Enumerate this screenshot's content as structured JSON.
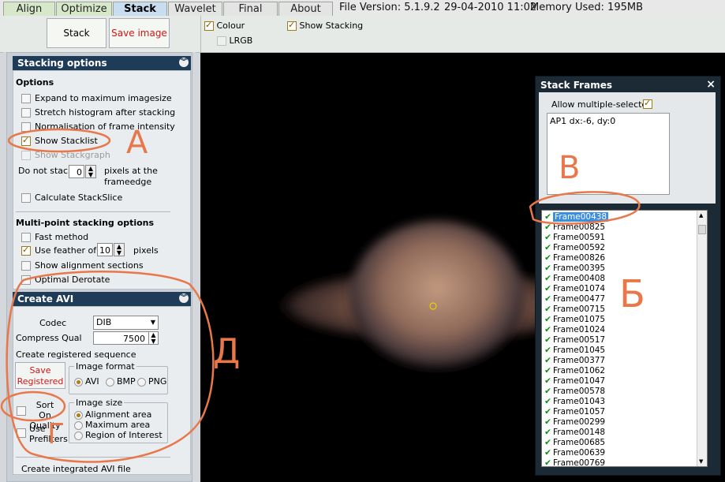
{
  "tabs": [
    {
      "label": "Align",
      "active": false
    },
    {
      "label": "Optimize",
      "active": false
    },
    {
      "label": "Stack",
      "active": true
    },
    {
      "label": "Wavelet",
      "active": false
    },
    {
      "label": "Final",
      "active": false
    },
    {
      "label": "About",
      "active": false
    }
  ],
  "status": {
    "file_version": "File Version: 5.1.9.2",
    "datetime": "29-04-2010 11:02",
    "memory": "Memory Used: 195MB"
  },
  "toolbar": {
    "stack_button": "Stack",
    "save_image_button": "Save image",
    "colour_label": "Colour",
    "colour_checked": true,
    "lrgb_label": "LRGB",
    "lrgb_checked": false,
    "show_stacking_label": "Show Stacking",
    "show_stacking_checked": true
  },
  "stacking_options": {
    "header": "Stacking options",
    "options_title": "Options",
    "expand": "Expand to maximum imagesize",
    "stretch": "Stretch histogram after stacking",
    "normalisation": "Normalisation of frame intensity",
    "show_stacklist": "Show Stacklist",
    "show_stackgraph": "Show Stackgraph",
    "do_not_stack": "Do not stack",
    "do_not_stack_value": "0",
    "pixels_edge": "pixels at the",
    "frameedge": "frameedge",
    "calc_stackslice": "Calculate StackSlice",
    "multipoint_title": "Multi-point stacking options",
    "fast_method": "Fast method",
    "use_feather": "Use feather of",
    "feather_value": "10",
    "pixels": "pixels",
    "show_alignment": "Show alignment sections",
    "optimal_derotate": "Optimal Derotate"
  },
  "create_avi": {
    "header": "Create AVI",
    "codec_label": "Codec",
    "codec_value": "DIB",
    "compress_label": "Compress Qual",
    "compress_value": "7500",
    "create_registered": "Create registered sequence",
    "save_registered": "Save Registered",
    "image_format": "Image format",
    "fmt_avi": "AVI",
    "fmt_bmp": "BMP",
    "fmt_png": "PNG",
    "sort_on_quality": "Sort On Quality",
    "use_prefilters": "Use Prefilters",
    "image_size": "Image size",
    "size_alignment": "Alignment area",
    "size_maximum": "Maximum area",
    "size_roi": "Region of Interest",
    "create_integrated": "Create integrated AVI file"
  },
  "stack_frames": {
    "title": "Stack Frames",
    "close": "×",
    "allow_multiple": "Allow multiple-selected",
    "ap_text": "AP1 dx:-6, dy:0",
    "frames": [
      "Frame00438",
      "Frame00825",
      "Frame00591",
      "Frame00592",
      "Frame00826",
      "Frame00395",
      "Frame00408",
      "Frame01074",
      "Frame00477",
      "Frame00715",
      "Frame01075",
      "Frame01024",
      "Frame00517",
      "Frame01045",
      "Frame00377",
      "Frame01062",
      "Frame01047",
      "Frame00578",
      "Frame01043",
      "Frame01057",
      "Frame00299",
      "Frame00148",
      "Frame00685",
      "Frame00639",
      "Frame00769"
    ],
    "selected_index": 0
  },
  "annotations": {
    "A": "A",
    "B": "B",
    "Б": "Б",
    "Д": "Д",
    "Г": "Г"
  },
  "colors": {
    "panel_header": "#1e3b58",
    "annotation": "#e8784a",
    "accent_check": "#a07a14"
  }
}
